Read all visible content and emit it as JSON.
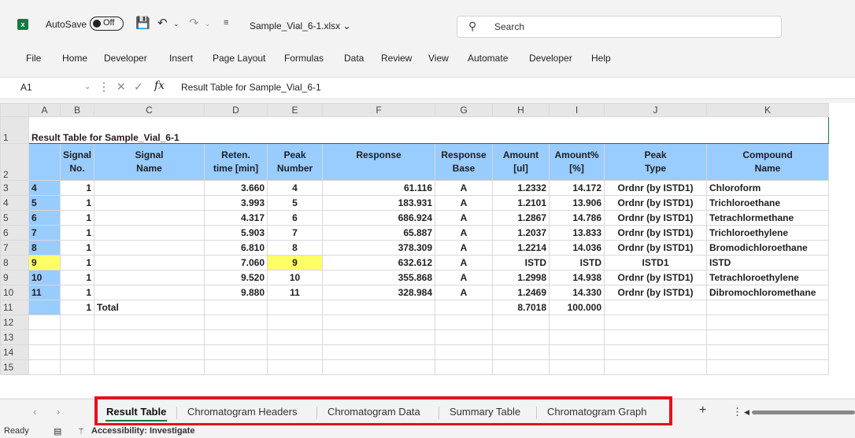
{
  "titlebar": {
    "autosave_label": "AutoSave",
    "autosave_state": "Off",
    "filename": "Sample_Vial_6-1.xlsx",
    "search_placeholder": "Search"
  },
  "menu": [
    "File",
    "Home",
    "Developer",
    "Insert",
    "Page Layout",
    "Formulas",
    "Data",
    "Review",
    "View",
    "Automate",
    "Developer",
    "Help"
  ],
  "formula_bar": {
    "name_box": "A1",
    "fx": "fx",
    "content": "Result Table for Sample_Vial_6-1"
  },
  "columns": [
    "A",
    "B",
    "C",
    "D",
    "E",
    "F",
    "G",
    "H",
    "I",
    "J",
    "K"
  ],
  "sheet": {
    "title": "Result Table for Sample_Vial_6-1",
    "headers": [
      [
        "Signal",
        "No."
      ],
      [
        "Signal",
        "Name"
      ],
      [
        "Reten.",
        "time [min]"
      ],
      [
        "Peak",
        "Number"
      ],
      [
        "Response",
        ""
      ],
      [
        "Response",
        "Base"
      ],
      [
        "Amount",
        "[ul]"
      ],
      [
        "Amount%",
        "[%]"
      ],
      [
        "Peak",
        "Type"
      ],
      [
        "Compound",
        "Name"
      ]
    ],
    "rows": [
      [
        "4",
        "1",
        "",
        "3.660",
        "4",
        "61.116",
        "A",
        "1.2332",
        "14.172",
        "Ordnr (by ISTD1)",
        "Chloroform"
      ],
      [
        "5",
        "1",
        "",
        "3.993",
        "5",
        "183.931",
        "A",
        "1.2101",
        "13.906",
        "Ordnr (by ISTD1)",
        "Trichloroethane"
      ],
      [
        "6",
        "1",
        "",
        "4.317",
        "6",
        "686.924",
        "A",
        "1.2867",
        "14.786",
        "Ordnr (by ISTD1)",
        "Tetrachlormethane"
      ],
      [
        "7",
        "1",
        "",
        "5.903",
        "7",
        "65.887",
        "A",
        "1.2037",
        "13.833",
        "Ordnr (by ISTD1)",
        "Trichloroethylene"
      ],
      [
        "8",
        "1",
        "",
        "6.810",
        "8",
        "378.309",
        "A",
        "1.2214",
        "14.036",
        "Ordnr (by ISTD1)",
        "Bromodichloroethane"
      ],
      [
        "9",
        "1",
        "",
        "7.060",
        "9",
        "632.612",
        "A",
        "ISTD",
        "ISTD",
        "ISTD1",
        "ISTD"
      ],
      [
        "10",
        "1",
        "",
        "9.520",
        "10",
        "355.868",
        "A",
        "1.2998",
        "14.938",
        "Ordnr (by ISTD1)",
        "Tetrachloroethylene"
      ],
      [
        "11",
        "1",
        "",
        "9.880",
        "11",
        "328.984",
        "A",
        "1.2469",
        "14.330",
        "Ordnr (by ISTD1)",
        "Dibromochloromethane"
      ],
      [
        "",
        "1",
        "Total",
        "",
        "",
        "",
        "",
        "8.7018",
        "100.000",
        "",
        ""
      ]
    ],
    "row_numbers": [
      "1",
      "2",
      "3",
      "4",
      "5",
      "6",
      "7",
      "8",
      "9",
      "10",
      "11",
      "12",
      "13",
      "14",
      "15"
    ]
  },
  "tabs": [
    "Result Table",
    "Chromatogram Headers",
    "Chromatogram Data",
    "Summary Table",
    "Chromatogram Graph"
  ],
  "status": {
    "ready": "Ready",
    "accessibility": "Accessibility: Investigate"
  },
  "colors": {
    "header_blue": "#99ccff",
    "highlight_yellow": "#ffff66",
    "excel_green": "#107c41",
    "callout_red": "#e5121b"
  }
}
